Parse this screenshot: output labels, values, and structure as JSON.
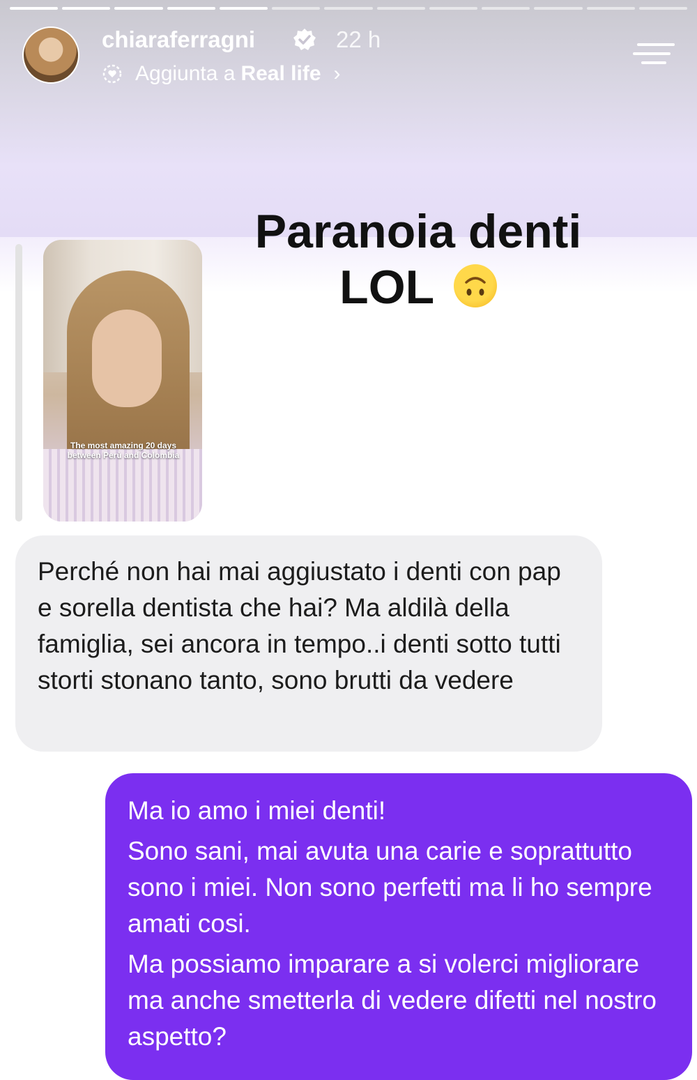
{
  "story": {
    "progress": {
      "total_segments": 13,
      "completed_segments": 5
    },
    "header": {
      "username": "chiaraferragni",
      "verified_icon": "verified-badge-icon",
      "time": "22 h",
      "added_prefix": "Aggiunta a",
      "highlight_name": "Real life",
      "chevron": "›",
      "menu_icon": "menu-icon"
    },
    "title": {
      "line1": "Paranoia denti",
      "line2": "LOL",
      "emoji": "upside-down-face-emoji"
    },
    "story_thumbnail": {
      "caption": "The most amazing 20 days between Perù and Colombia"
    },
    "messages": {
      "incoming": "Perché non hai mai aggiustato i denti con pap e sorella dentista che hai? Ma aldilà della famiglia, sei ancora in tempo..i denti sotto tutti storti stonano tanto, sono brutti da vedere",
      "outgoing": [
        "Ma io amo i miei denti!",
        "Sono sani, mai avuta una carie e soprattutto sono i miei. Non sono perfetti ma li ho sempre amati cosi.",
        "Ma possiamo imparare a si volerci migliorare ma anche smetterla di vedere difetti nel nostro aspetto?"
      ]
    },
    "colors": {
      "outgoing_bubble": "#7b2ff0",
      "incoming_bubble": "#efeff1",
      "header_gradient": "#e4dcf6"
    }
  }
}
